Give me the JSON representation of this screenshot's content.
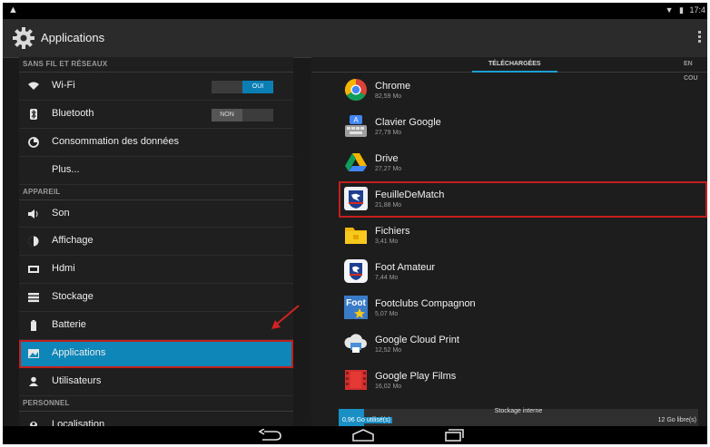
{
  "statusbar": {
    "warning_icon": "warning-icon",
    "wifi_icon": "wifi-icon",
    "battery_icon": "battery-icon",
    "time": "17:4"
  },
  "actionbar": {
    "title": "Applications",
    "icon": "gear-icon",
    "menu_icon": "overflow-menu-icon"
  },
  "sidebar": {
    "sections": {
      "wireless": "SANS FIL ET RÉSEAUX",
      "device": "APPAREIL",
      "personal": "PERSONNEL"
    },
    "items": [
      {
        "label": "Wi-Fi",
        "icon": "wifi-icon",
        "toggle": "OUI",
        "toggle_state": "on"
      },
      {
        "label": "Bluetooth",
        "icon": "bluetooth-icon",
        "toggle": "NON",
        "toggle_state": "off"
      },
      {
        "label": "Consommation des données",
        "icon": "data-usage-icon"
      },
      {
        "label": "Plus...",
        "icon": ""
      },
      {
        "label": "Son",
        "icon": "speaker-icon"
      },
      {
        "label": "Affichage",
        "icon": "display-icon"
      },
      {
        "label": "Hdmi",
        "icon": "hdmi-icon"
      },
      {
        "label": "Stockage",
        "icon": "storage-icon"
      },
      {
        "label": "Batterie",
        "icon": "battery-icon"
      },
      {
        "label": "Applications",
        "icon": "applications-icon",
        "selected": true
      },
      {
        "label": "Utilisateurs",
        "icon": "users-icon"
      },
      {
        "label": "Localisation",
        "icon": "location-icon"
      }
    ]
  },
  "tabs": {
    "active": "TÉLÉCHARGÉES",
    "next": "EN COU"
  },
  "apps": [
    {
      "name": "Chrome",
      "size": "82,59 Mo",
      "icon": "chrome-icon"
    },
    {
      "name": "Clavier Google",
      "size": "27,79 Mo",
      "icon": "keyboard-icon"
    },
    {
      "name": "Drive",
      "size": "27,27 Mo",
      "icon": "drive-icon"
    },
    {
      "name": "FeuilleDeMatch",
      "size": "21,88 Mo",
      "icon": "fff-logo-icon",
      "highlighted": true
    },
    {
      "name": "Fichiers",
      "size": "3,41 Mo",
      "icon": "folder-icon"
    },
    {
      "name": "Foot Amateur",
      "size": "7,44 Mo",
      "icon": "fff-logo-icon"
    },
    {
      "name": "Footclubs Compagnon",
      "size": "5,07 Mo",
      "icon": "footclubs-icon"
    },
    {
      "name": "Google Cloud Print",
      "size": "12,52 Mo",
      "icon": "cloud-print-icon"
    },
    {
      "name": "Google Play Films",
      "size": "16,02 Mo",
      "icon": "film-icon"
    }
  ],
  "storage": {
    "title": "Stockage interne",
    "used": "0,96 Go utilisé(s)",
    "free": "12 Go libre(s)",
    "used_fraction": 0.07
  },
  "navbar": {
    "back_icon": "back-icon",
    "home_icon": "home-icon",
    "recents_icon": "recents-icon"
  },
  "colors": {
    "accent": "#0e86b7",
    "highlight_border": "#c41f1f"
  }
}
